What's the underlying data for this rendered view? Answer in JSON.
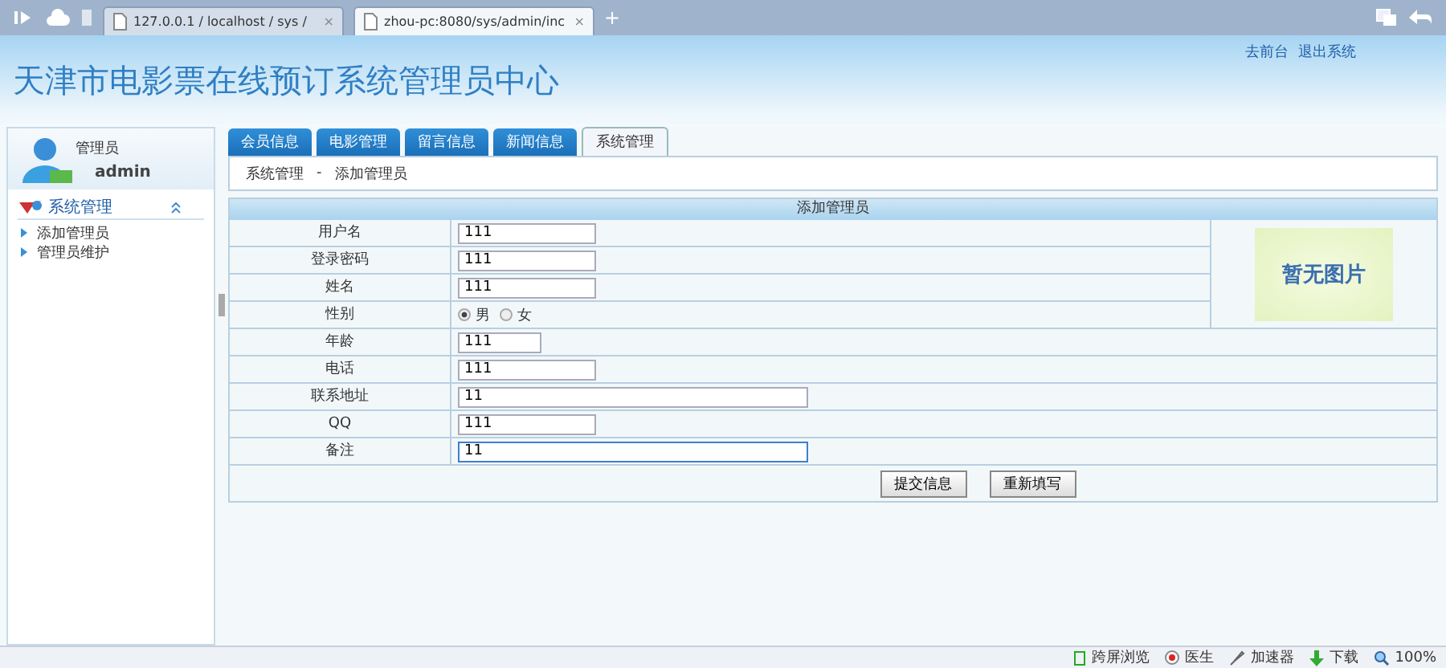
{
  "browser": {
    "tabs": [
      {
        "title": "127.0.0.1 / localhost / sys /",
        "selected": false
      },
      {
        "title": "zhou-pc:8080/sys/admin/inc",
        "selected": true
      }
    ],
    "close": "×",
    "new_tab": "+"
  },
  "header": {
    "title": "天津市电影票在线预订系统管理员中心",
    "links": [
      "去前台",
      "退出系统"
    ]
  },
  "user": {
    "role": "管理员",
    "name": "admin"
  },
  "nav_tabs": [
    {
      "label": "会员信息",
      "selected": false
    },
    {
      "label": "电影管理",
      "selected": false
    },
    {
      "label": "留言信息",
      "selected": false
    },
    {
      "label": "新闻信息",
      "selected": false
    },
    {
      "label": "系统管理",
      "selected": true
    }
  ],
  "breadcrumb": [
    "系统管理",
    "-",
    "添加管理员"
  ],
  "sidebar": {
    "section": "系统管理",
    "expanded": true,
    "items": [
      "添加管理员",
      "管理员维护"
    ]
  },
  "form": {
    "title": "添加管理员",
    "image_text": "暂无图片",
    "fields": [
      {
        "label": "用户名",
        "kind": "medium",
        "value": "111",
        "focused": false
      },
      {
        "label": "登录密码",
        "kind": "medium",
        "value": "111",
        "focused": false
      },
      {
        "label": "姓名",
        "kind": "medium",
        "value": "111",
        "focused": false
      },
      {
        "label": "性别",
        "kind": "radio",
        "options": [
          {
            "label": "男",
            "selected": true
          },
          {
            "label": "女",
            "selected": false
          }
        ]
      },
      {
        "label": "年龄",
        "kind": "short",
        "value": "111",
        "focused": false
      },
      {
        "label": "电话",
        "kind": "medium",
        "value": "111",
        "focused": false
      },
      {
        "label": "联系地址",
        "kind": "long",
        "value": "11",
        "focused": false
      },
      {
        "label": "QQ",
        "kind": "medium",
        "value": "111",
        "focused": false
      },
      {
        "label": "备注",
        "kind": "long",
        "value": "11",
        "focused": true
      }
    ],
    "buttons": [
      "提交信息",
      "重新填写"
    ]
  },
  "status_bar": [
    "跨屏浏览",
    "医生",
    "加速器",
    "下载",
    "100%"
  ]
}
